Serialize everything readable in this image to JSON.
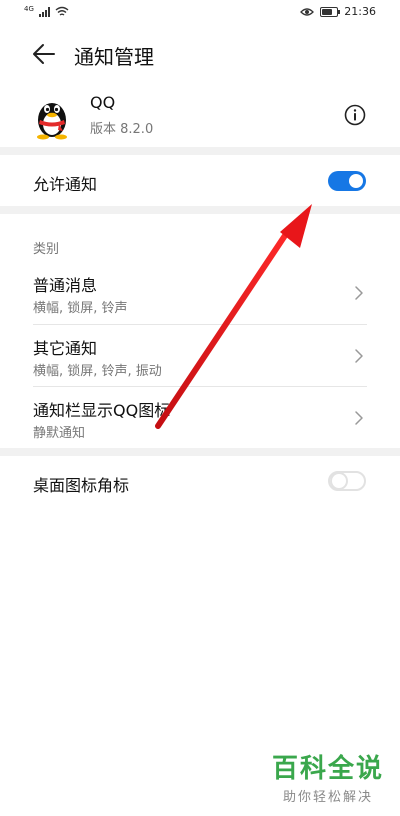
{
  "status_bar": {
    "network": "4G",
    "time": "21:36",
    "battery_level": 0.8
  },
  "header": {
    "title": "通知管理"
  },
  "app": {
    "name": "QQ",
    "version": "版本 8.2.0"
  },
  "allow_notifications": {
    "label": "允许通知",
    "enabled": true
  },
  "category": {
    "title": "类别",
    "items": [
      {
        "label": "普通消息",
        "sub": "横幅, 锁屏, 铃声"
      },
      {
        "label": "其它通知",
        "sub": "横幅, 锁屏, 铃声, 振动"
      },
      {
        "label": "通知栏显示QQ图标",
        "sub": "静默通知"
      }
    ]
  },
  "badge": {
    "label": "桌面图标角标",
    "enabled": false
  },
  "annotation": {
    "arrow_color": "#e8161a"
  },
  "watermark": {
    "title": "百科全说",
    "subtitle": "助你轻松解决"
  },
  "colors": {
    "accent": "#1677e5",
    "watermark": "#3aa74c"
  }
}
